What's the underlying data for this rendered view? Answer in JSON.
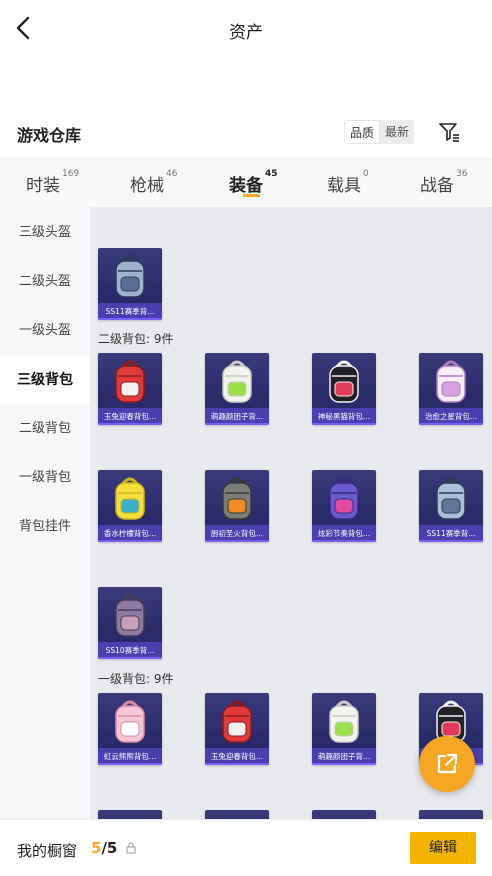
{
  "page": {
    "title": "资产"
  },
  "warehouse": {
    "title": "游戏仓库",
    "sort_options": [
      "品质",
      "最新"
    ],
    "filter_icon": "filter-icon"
  },
  "tabs": [
    {
      "label": "时装",
      "count": "169"
    },
    {
      "label": "枪械",
      "count": "46"
    },
    {
      "label": "装备",
      "count": "45"
    },
    {
      "label": "载具",
      "count": "0"
    },
    {
      "label": "战备",
      "count": "36"
    }
  ],
  "active_tab": "装备",
  "sidebar": {
    "items": [
      "三级头盔",
      "二级头盔",
      "一级头盔",
      "三级背包",
      "二级背包",
      "一级背包",
      "背包挂件"
    ],
    "active": "三级背包"
  },
  "sections": {
    "level3_items": [
      {
        "name": "SS11赛季背...",
        "icon": "backpack-stars-icon"
      }
    ],
    "level2_label": "二级背包: 9件",
    "level2_items": [
      {
        "name": "玉兔迎春背包...",
        "icon": "backpack-red-icon"
      },
      {
        "name": "萌趣颜团子背...",
        "icon": "backpack-bunny-icon"
      },
      {
        "name": "神秘黑猫背包...",
        "icon": "backpack-blackcat-icon"
      },
      {
        "name": "治愈之星背包...",
        "icon": "backpack-pink-icon"
      },
      {
        "name": "香水柠檬背包...",
        "icon": "backpack-lemon-icon"
      },
      {
        "name": "厨初圣火背包...",
        "icon": "backpack-torch-icon"
      },
      {
        "name": "炫彩节奏背包...",
        "icon": "backpack-colorful-icon"
      },
      {
        "name": "SS11赛季背...",
        "icon": "backpack-season11-icon"
      },
      {
        "name": "SS10赛季背...",
        "icon": "backpack-season10-icon"
      }
    ],
    "level1_label": "一级背包: 9件",
    "level1_items": [
      {
        "name": "虹云熊熊背包...",
        "icon": "backpack-cloudbear-icon"
      },
      {
        "name": "玉兔迎春背包...",
        "icon": "backpack-red-icon"
      },
      {
        "name": "萌趣颜团子背...",
        "icon": "backpack-bunny-icon"
      },
      {
        "name": "",
        "icon": "backpack-blackcat-icon"
      }
    ]
  },
  "bottom": {
    "label": "我的橱窗",
    "count_current": "5",
    "count_sep": "/",
    "count_total": "5",
    "edit_label": "编辑"
  },
  "colors": {
    "accent": "#f5a623",
    "edit_button": "#f5b301",
    "item_caption": "#4b3fb0"
  }
}
